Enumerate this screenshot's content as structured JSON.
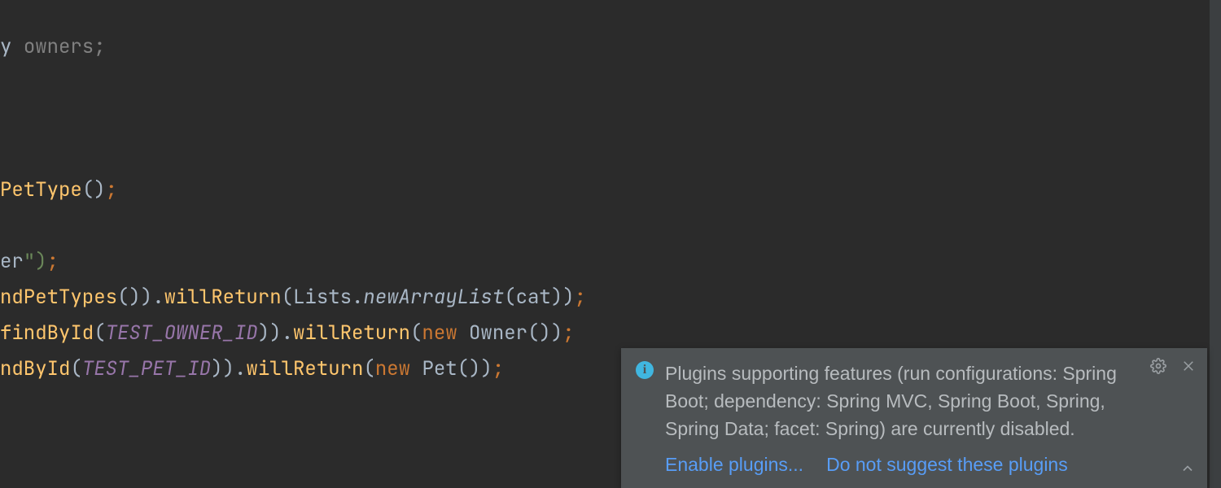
{
  "code": {
    "lines": [
      [
        {
          "cls": "t-plain",
          "text": "y "
        },
        {
          "cls": "t-comment",
          "text": "owners;"
        }
      ],
      [],
      [],
      [],
      [
        {
          "cls": "t-method",
          "text": "PetType"
        },
        {
          "cls": "t-paren",
          "text": "()"
        },
        {
          "cls": "t-semi",
          "text": ";"
        }
      ],
      [],
      [
        {
          "cls": "t-plain",
          "text": "er"
        },
        {
          "cls": "t-string",
          "text": "\")"
        },
        {
          "cls": "t-semi",
          "text": ";"
        }
      ],
      [
        {
          "cls": "t-method",
          "text": "ndPetTypes"
        },
        {
          "cls": "t-paren",
          "text": "())."
        },
        {
          "cls": "t-method",
          "text": "willReturn"
        },
        {
          "cls": "t-paren",
          "text": "("
        },
        {
          "cls": "t-type",
          "text": "Lists"
        },
        {
          "cls": "t-paren",
          "text": "."
        },
        {
          "cls": "t-static",
          "text": "newArrayList"
        },
        {
          "cls": "t-paren",
          "text": "(cat))"
        },
        {
          "cls": "t-semi",
          "text": ";"
        }
      ],
      [
        {
          "cls": "t-method",
          "text": "findById"
        },
        {
          "cls": "t-paren",
          "text": "("
        },
        {
          "cls": "t-const",
          "text": "TEST_OWNER_ID"
        },
        {
          "cls": "t-paren",
          "text": "))."
        },
        {
          "cls": "t-method",
          "text": "willReturn"
        },
        {
          "cls": "t-paren",
          "text": "("
        },
        {
          "cls": "t-keyword",
          "text": "new "
        },
        {
          "cls": "t-type",
          "text": "Owner"
        },
        {
          "cls": "t-paren",
          "text": "())"
        },
        {
          "cls": "t-semi",
          "text": ";"
        }
      ],
      [
        {
          "cls": "t-method",
          "text": "ndById"
        },
        {
          "cls": "t-paren",
          "text": "("
        },
        {
          "cls": "t-const",
          "text": "TEST_PET_ID"
        },
        {
          "cls": "t-paren",
          "text": "))."
        },
        {
          "cls": "t-method",
          "text": "willReturn"
        },
        {
          "cls": "t-paren",
          "text": "("
        },
        {
          "cls": "t-keyword",
          "text": "new "
        },
        {
          "cls": "t-type",
          "text": "Pet"
        },
        {
          "cls": "t-paren",
          "text": "())"
        },
        {
          "cls": "t-semi",
          "text": ";"
        }
      ]
    ]
  },
  "notification": {
    "message": "Plugins supporting features (run configurations: Spring Boot; dependency: Spring MVC, Spring Boot, Spring, Spring Data; facet: Spring) are currently disabled.",
    "action_enable": "Enable plugins...",
    "action_dismiss": "Do not suggest these plugins",
    "info_glyph": "i"
  }
}
